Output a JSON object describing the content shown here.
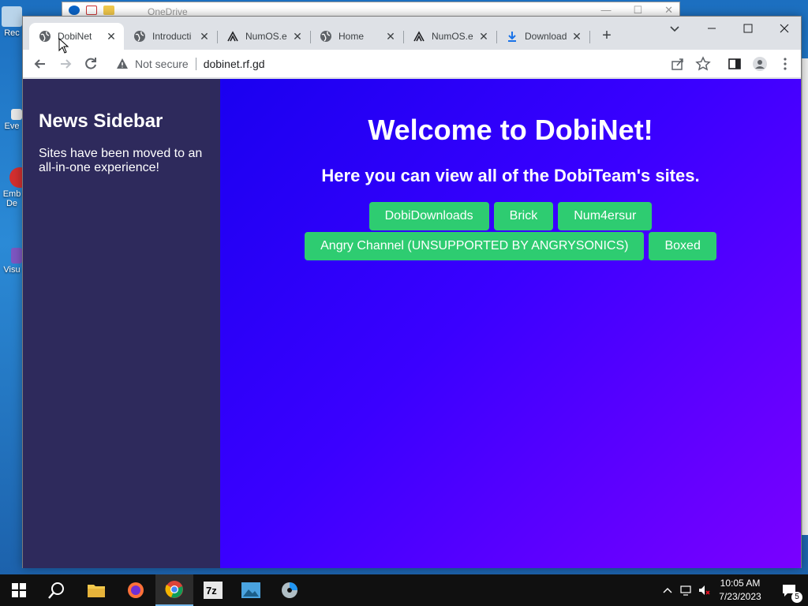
{
  "desktop": {
    "icons": [
      {
        "label": "Rec"
      },
      {
        "label": "Eve"
      },
      {
        "label": "Emb De"
      },
      {
        "label": "Visu"
      }
    ],
    "background_window": {
      "title": "OneDrive"
    }
  },
  "browser": {
    "tabs": [
      {
        "title": "DobiNet",
        "icon": "globe-icon",
        "active": true
      },
      {
        "title": "Introducti",
        "icon": "globe-icon",
        "active": false
      },
      {
        "title": "NumOS.e",
        "icon": "numos-icon",
        "active": false
      },
      {
        "title": "Home",
        "icon": "globe-icon",
        "active": false
      },
      {
        "title": "NumOS.e",
        "icon": "numos-icon",
        "active": false
      },
      {
        "title": "Download",
        "icon": "download-icon",
        "active": false
      }
    ],
    "address": {
      "security_label": "Not secure",
      "url": "dobinet.rf.gd"
    }
  },
  "page": {
    "sidebar": {
      "title": "News Sidebar",
      "text": "Sites have been moved to an all-in-one experience!"
    },
    "main": {
      "title": "Welcome to DobiNet!",
      "subtitle": "Here you can view all of the DobiTeam's sites.",
      "buttons_row1": [
        "DobiDownloads",
        "Brick",
        "Num4ersur"
      ],
      "buttons_row2": [
        "Angry Channel (UNSUPPORTED BY ANGRYSONICS)",
        "Boxed"
      ]
    }
  },
  "taskbar": {
    "clock_time": "10:05 AM",
    "clock_date": "7/23/2023",
    "notification_count": "5"
  },
  "colors": {
    "accent_button": "#2ecc71",
    "sidebar_bg": "#2e2a5c",
    "main_gradient_start": "#1a00f0",
    "main_gradient_end": "#7a00ff"
  }
}
